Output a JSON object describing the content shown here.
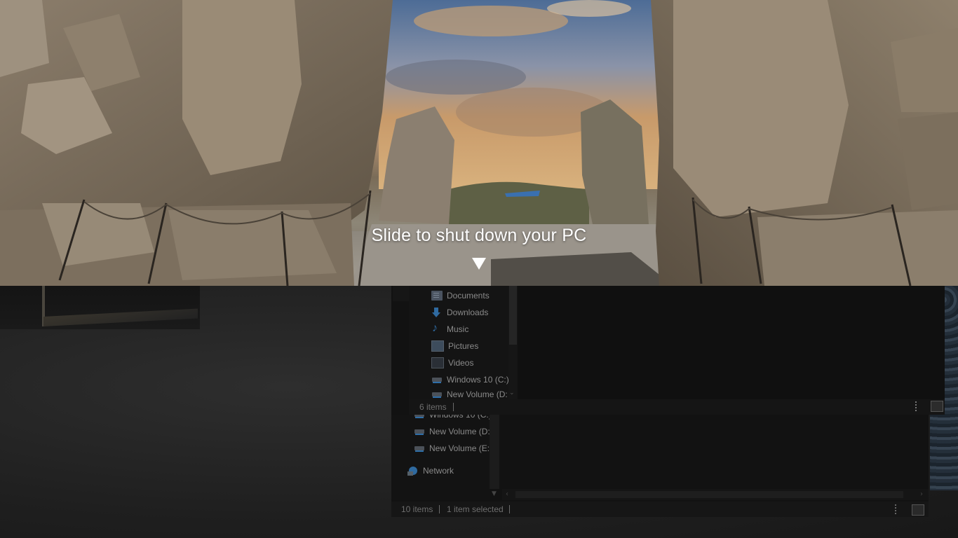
{
  "shutdown": {
    "message": "Slide to shut down your PC",
    "arrow_icon": "down-arrow-icon"
  },
  "front_window": {
    "nav_items": [
      {
        "label": "Documents",
        "icon": "documents-icon"
      },
      {
        "label": "Downloads",
        "icon": "downloads-icon"
      },
      {
        "label": "Music",
        "icon": "music-icon"
      },
      {
        "label": "Pictures",
        "icon": "pictures-icon"
      },
      {
        "label": "Videos",
        "icon": "videos-icon"
      },
      {
        "label": "Windows 10 (C:)",
        "icon": "drive-icon"
      },
      {
        "label": "New Volume (D:",
        "icon": "drive-icon"
      }
    ],
    "status": {
      "item_count": "6 items"
    }
  },
  "back_window": {
    "nav_items": [
      {
        "label": "Windows 10 (C:)",
        "icon": "drive-icon"
      },
      {
        "label": "New Volume (D:",
        "icon": "drive-icon"
      },
      {
        "label": "New Volume (E:)",
        "icon": "drive-icon"
      },
      {
        "label": "Network",
        "icon": "network-icon"
      }
    ],
    "status": {
      "item_count": "10 items",
      "selection": "1 item selected"
    }
  },
  "colors": {
    "overlay_text": "#ffffff",
    "explorer_bg": "#111111",
    "dim_text": "#8a8a8a"
  }
}
